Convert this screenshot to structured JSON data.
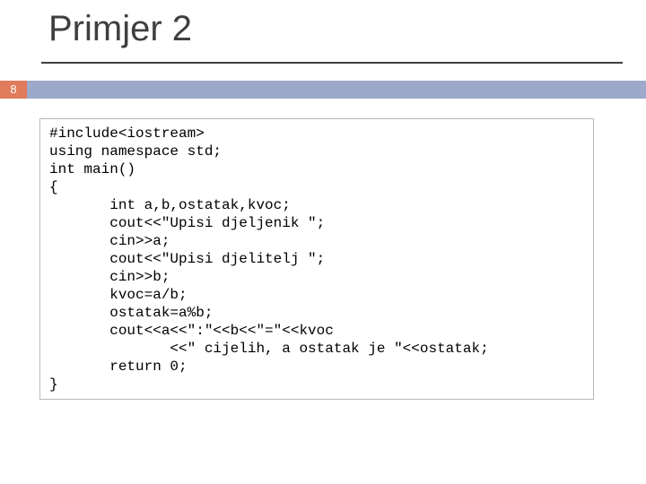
{
  "slide": {
    "title": "Primjer 2",
    "page_number": "8"
  },
  "code": {
    "l01": "#include<iostream>",
    "l02": "using namespace std;",
    "l03": "int main()",
    "l04": "{",
    "l05": "       int a,b,ostatak,kvoc;",
    "l06": "       cout<<\"Upisi djeljenik \";",
    "l07": "       cin>>a;",
    "l08": "       cout<<\"Upisi djelitelj \";",
    "l09": "       cin>>b;",
    "l10": "       kvoc=a/b;",
    "l11": "       ostatak=a%b;",
    "l12": "       cout<<a<<\":\"<<b<<\"=\"<<kvoc",
    "l13": "              <<\" cijelih, a ostatak je \"<<ostatak;",
    "l14": "       return 0;",
    "l15": "}"
  }
}
